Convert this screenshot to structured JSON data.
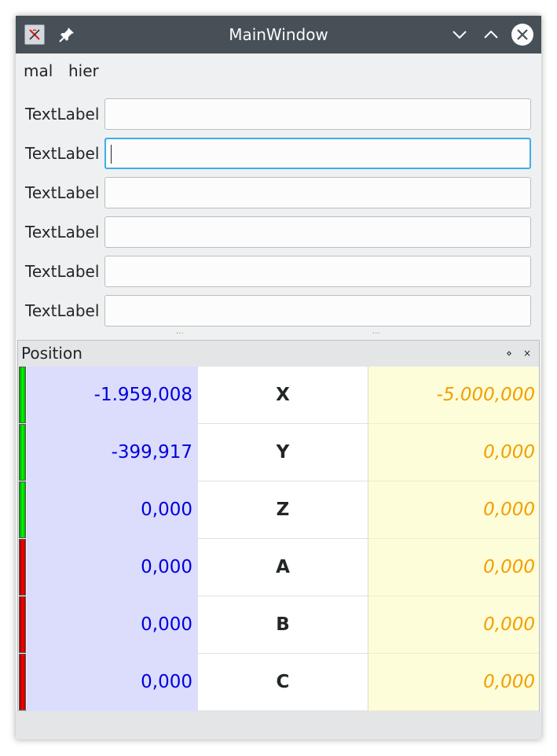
{
  "window": {
    "title": "MainWindow"
  },
  "menubar": {
    "items": [
      "mal",
      "hier"
    ]
  },
  "form": {
    "rows": [
      {
        "label": "TextLabel",
        "value": ""
      },
      {
        "label": "TextLabel",
        "value": ""
      },
      {
        "label": "TextLabel",
        "value": ""
      },
      {
        "label": "TextLabel",
        "value": ""
      },
      {
        "label": "TextLabel",
        "value": ""
      },
      {
        "label": "TextLabel",
        "value": ""
      }
    ]
  },
  "dock": {
    "title": "Position",
    "float_symbol": "⋄",
    "close_symbol": "×",
    "axes": [
      {
        "status": "green",
        "value": "-1.959,008",
        "name": "X",
        "target": "-5.000,000"
      },
      {
        "status": "green",
        "value": "-399,917",
        "name": "Y",
        "target": "0,000"
      },
      {
        "status": "green",
        "value": "0,000",
        "name": "Z",
        "target": "0,000"
      },
      {
        "status": "red",
        "value": "0,000",
        "name": "A",
        "target": "0,000"
      },
      {
        "status": "red",
        "value": "0,000",
        "name": "B",
        "target": "0,000"
      },
      {
        "status": "red",
        "value": "0,000",
        "name": "C",
        "target": "0,000"
      }
    ]
  },
  "colors": {
    "titlebar": "#475057",
    "value_text": "#0000dd",
    "value_bg": "#dcdcfd",
    "target_text": "#f0a000",
    "target_bg": "#fefdda",
    "focus_border": "#3daee9",
    "led_ok": "#00ff00",
    "led_error": "#ff0000"
  },
  "icons": {
    "app": "app-icon",
    "pin": "pin-icon",
    "minimize": "chevron-down-icon",
    "maximize": "chevron-up-icon",
    "close": "close-icon"
  }
}
